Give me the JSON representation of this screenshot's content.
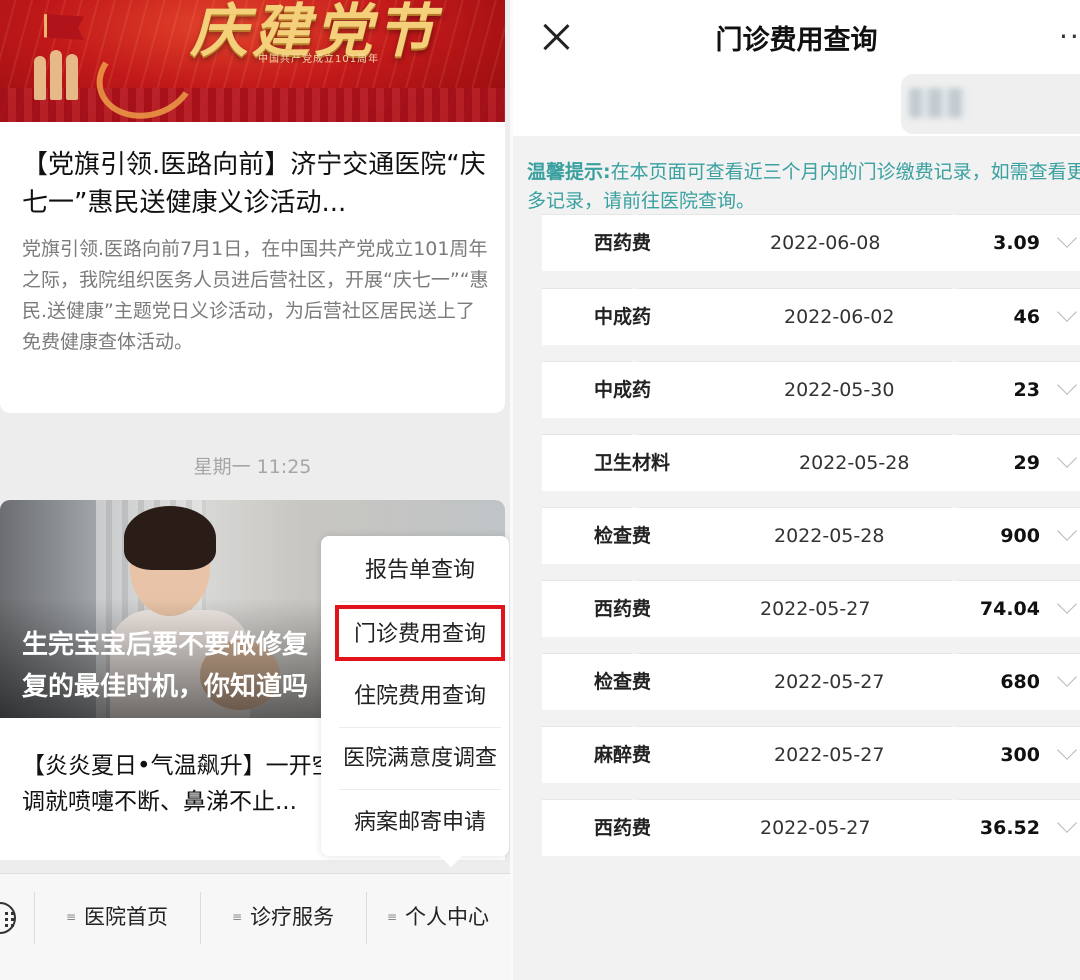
{
  "left": {
    "banner": {
      "headline": "庆建党节",
      "subtitle": "中国共产党成立101周年"
    },
    "article1": {
      "title": "【党旗引领.医路向前】济宁交通医院“庆七一”惠民送健康义诊活动...",
      "summary": "党旗引领.医路向前7月1日，在中国共产党成立101周年之际，我院组织医务人员进后营社区，开展“庆七一”“惠民.送健康”主题党日义诊活动，为后营社区居民送上了免费健康查体活动。"
    },
    "timestamp": "星期一 11:25",
    "article2": {
      "title_line1": "生完宝宝后要不要做修复",
      "title_line2": "复的最佳时机，你知道吗"
    },
    "article3": {
      "title_line1": "【炎炎夏日•气温飙升】一开空",
      "title_line2": "调就喷嚏不断、鼻涕不止..."
    },
    "popup_menu": [
      {
        "label": "报告单查询"
      },
      {
        "label": "门诊费用查询"
      },
      {
        "label": "住院费用查询"
      },
      {
        "label": "医院满意度调查"
      },
      {
        "label": "病案邮寄申请"
      }
    ],
    "tabs": [
      {
        "label": "医院首页"
      },
      {
        "label": "诊疗服务"
      },
      {
        "label": "个人中心"
      }
    ],
    "colors": {
      "highlight": "#e0141a"
    }
  },
  "right": {
    "title": "门诊费用查询",
    "tip_label": "温馨提示:",
    "tip_text": "在本页面可查看近三个月内的门诊缴费记录，如需查看更多记录，请前往医院查询。",
    "records": [
      {
        "category": "西药费",
        "date": "2022-06-08",
        "amount": "3.09"
      },
      {
        "category": "中成药",
        "date": "2022-06-02",
        "amount": "46"
      },
      {
        "category": "中成药",
        "date": "2022-05-30",
        "amount": "23"
      },
      {
        "category": "卫生材料",
        "date": "2022-05-28",
        "amount": "29"
      },
      {
        "category": "检查费",
        "date": "2022-05-28",
        "amount": "900"
      },
      {
        "category": "西药费",
        "date": "2022-05-27",
        "amount": "74.04"
      },
      {
        "category": "检查费",
        "date": "2022-05-27",
        "amount": "680"
      },
      {
        "category": "麻醉费",
        "date": "2022-05-27",
        "amount": "300"
      },
      {
        "category": "西药费",
        "date": "2022-05-27",
        "amount": "36.52"
      }
    ],
    "colors": {
      "tip": "#3aa0a0"
    }
  }
}
